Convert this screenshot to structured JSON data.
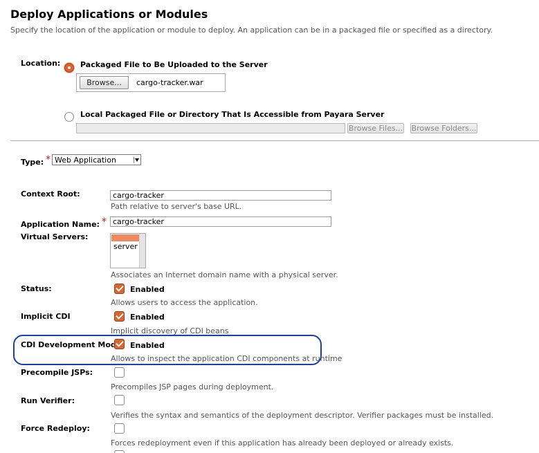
{
  "page": {
    "title": "Deploy Applications or Modules",
    "description": "Specify the location of the application or module to deploy. An application can be in a packaged file or specified as a directory."
  },
  "location": {
    "label": "Location:",
    "option_upload": {
      "label": "Packaged File to Be Uploaded to the Server",
      "selected": true
    },
    "browse_label": "Browse...",
    "file_name": "cargo-tracker.war",
    "option_local": {
      "label": "Local Packaged File or Directory That Is Accessible from Payara Server",
      "selected": false
    },
    "local_path_value": "",
    "browse_files_label": "Browse Files...",
    "browse_folders_label": "Browse Folders..."
  },
  "type": {
    "label": "Type:",
    "required_mark": "*",
    "selected": "Web Application"
  },
  "context_root": {
    "label": "Context Root:",
    "value": "cargo-tracker",
    "help": "Path relative to server's base URL."
  },
  "app_name": {
    "label": "Application Name:",
    "required_mark": "*",
    "value": "cargo-tracker"
  },
  "virtual_servers": {
    "label": "Virtual Servers:",
    "options": [
      "server"
    ],
    "help": "Associates an Internet domain name with a physical server."
  },
  "status": {
    "label": "Status:",
    "checkbox_label": "Enabled",
    "checked": true,
    "help": "Allows users to access the application."
  },
  "implicit_cdi": {
    "label": "Implicit CDI",
    "checkbox_label": "Enabled",
    "checked": true,
    "help": "Implicit discovery of CDI beans"
  },
  "cdi_dev_mode": {
    "label": "CDI Development Mode",
    "checkbox_label": "Enabled",
    "checked": true,
    "help": "Allows to inspect the application CDI components at runtime"
  },
  "precompile_jsps": {
    "label": "Precompile JSPs:",
    "checked": false,
    "help": "Precompiles JSP pages during deployment."
  },
  "run_verifier": {
    "label": "Run Verifier:",
    "checked": false,
    "help": "Verifies the syntax and semantics of the deployment descriptor. Verifier packages must be installed."
  },
  "force_redeploy": {
    "label": "Force Redeploy:",
    "checked": false,
    "help": "Forces redeployment even if this application has already been deployed or already exists."
  },
  "colors": {
    "accent": "#d9662e",
    "highlight_outline": "#1a3fb0",
    "required": "#c01818"
  }
}
